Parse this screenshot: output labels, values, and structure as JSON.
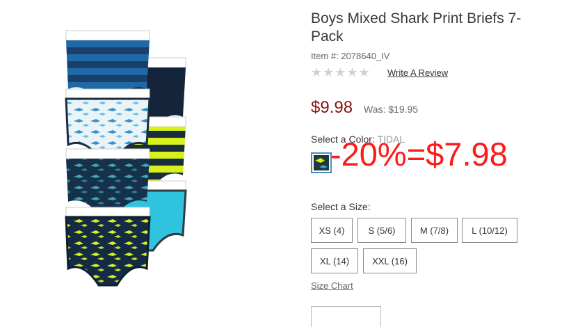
{
  "product": {
    "title": "Boys Mixed Shark Print Briefs 7-Pack",
    "item_number": "Item #: 2078640_IV",
    "review_link": "Write A Review",
    "rating_stars": 0,
    "price": "$9.98",
    "was_price": "Was: $19.95",
    "color_label": "Select a Color:",
    "color_value": "TIDAL",
    "discount_overlay": "-20%=$7.98",
    "size_label": "Select a Size:",
    "sizes": [
      "XS (4)",
      "S (5/6)",
      "M (7/8)",
      "L (10/12)",
      "XL (14)",
      "XXL (16)"
    ],
    "size_chart_link": "Size Chart"
  },
  "colors": {
    "price": "#8b1212",
    "discount": "#ff1a1a",
    "swatch_border": "#4a8cca",
    "star_empty": "#d0d0d0"
  }
}
